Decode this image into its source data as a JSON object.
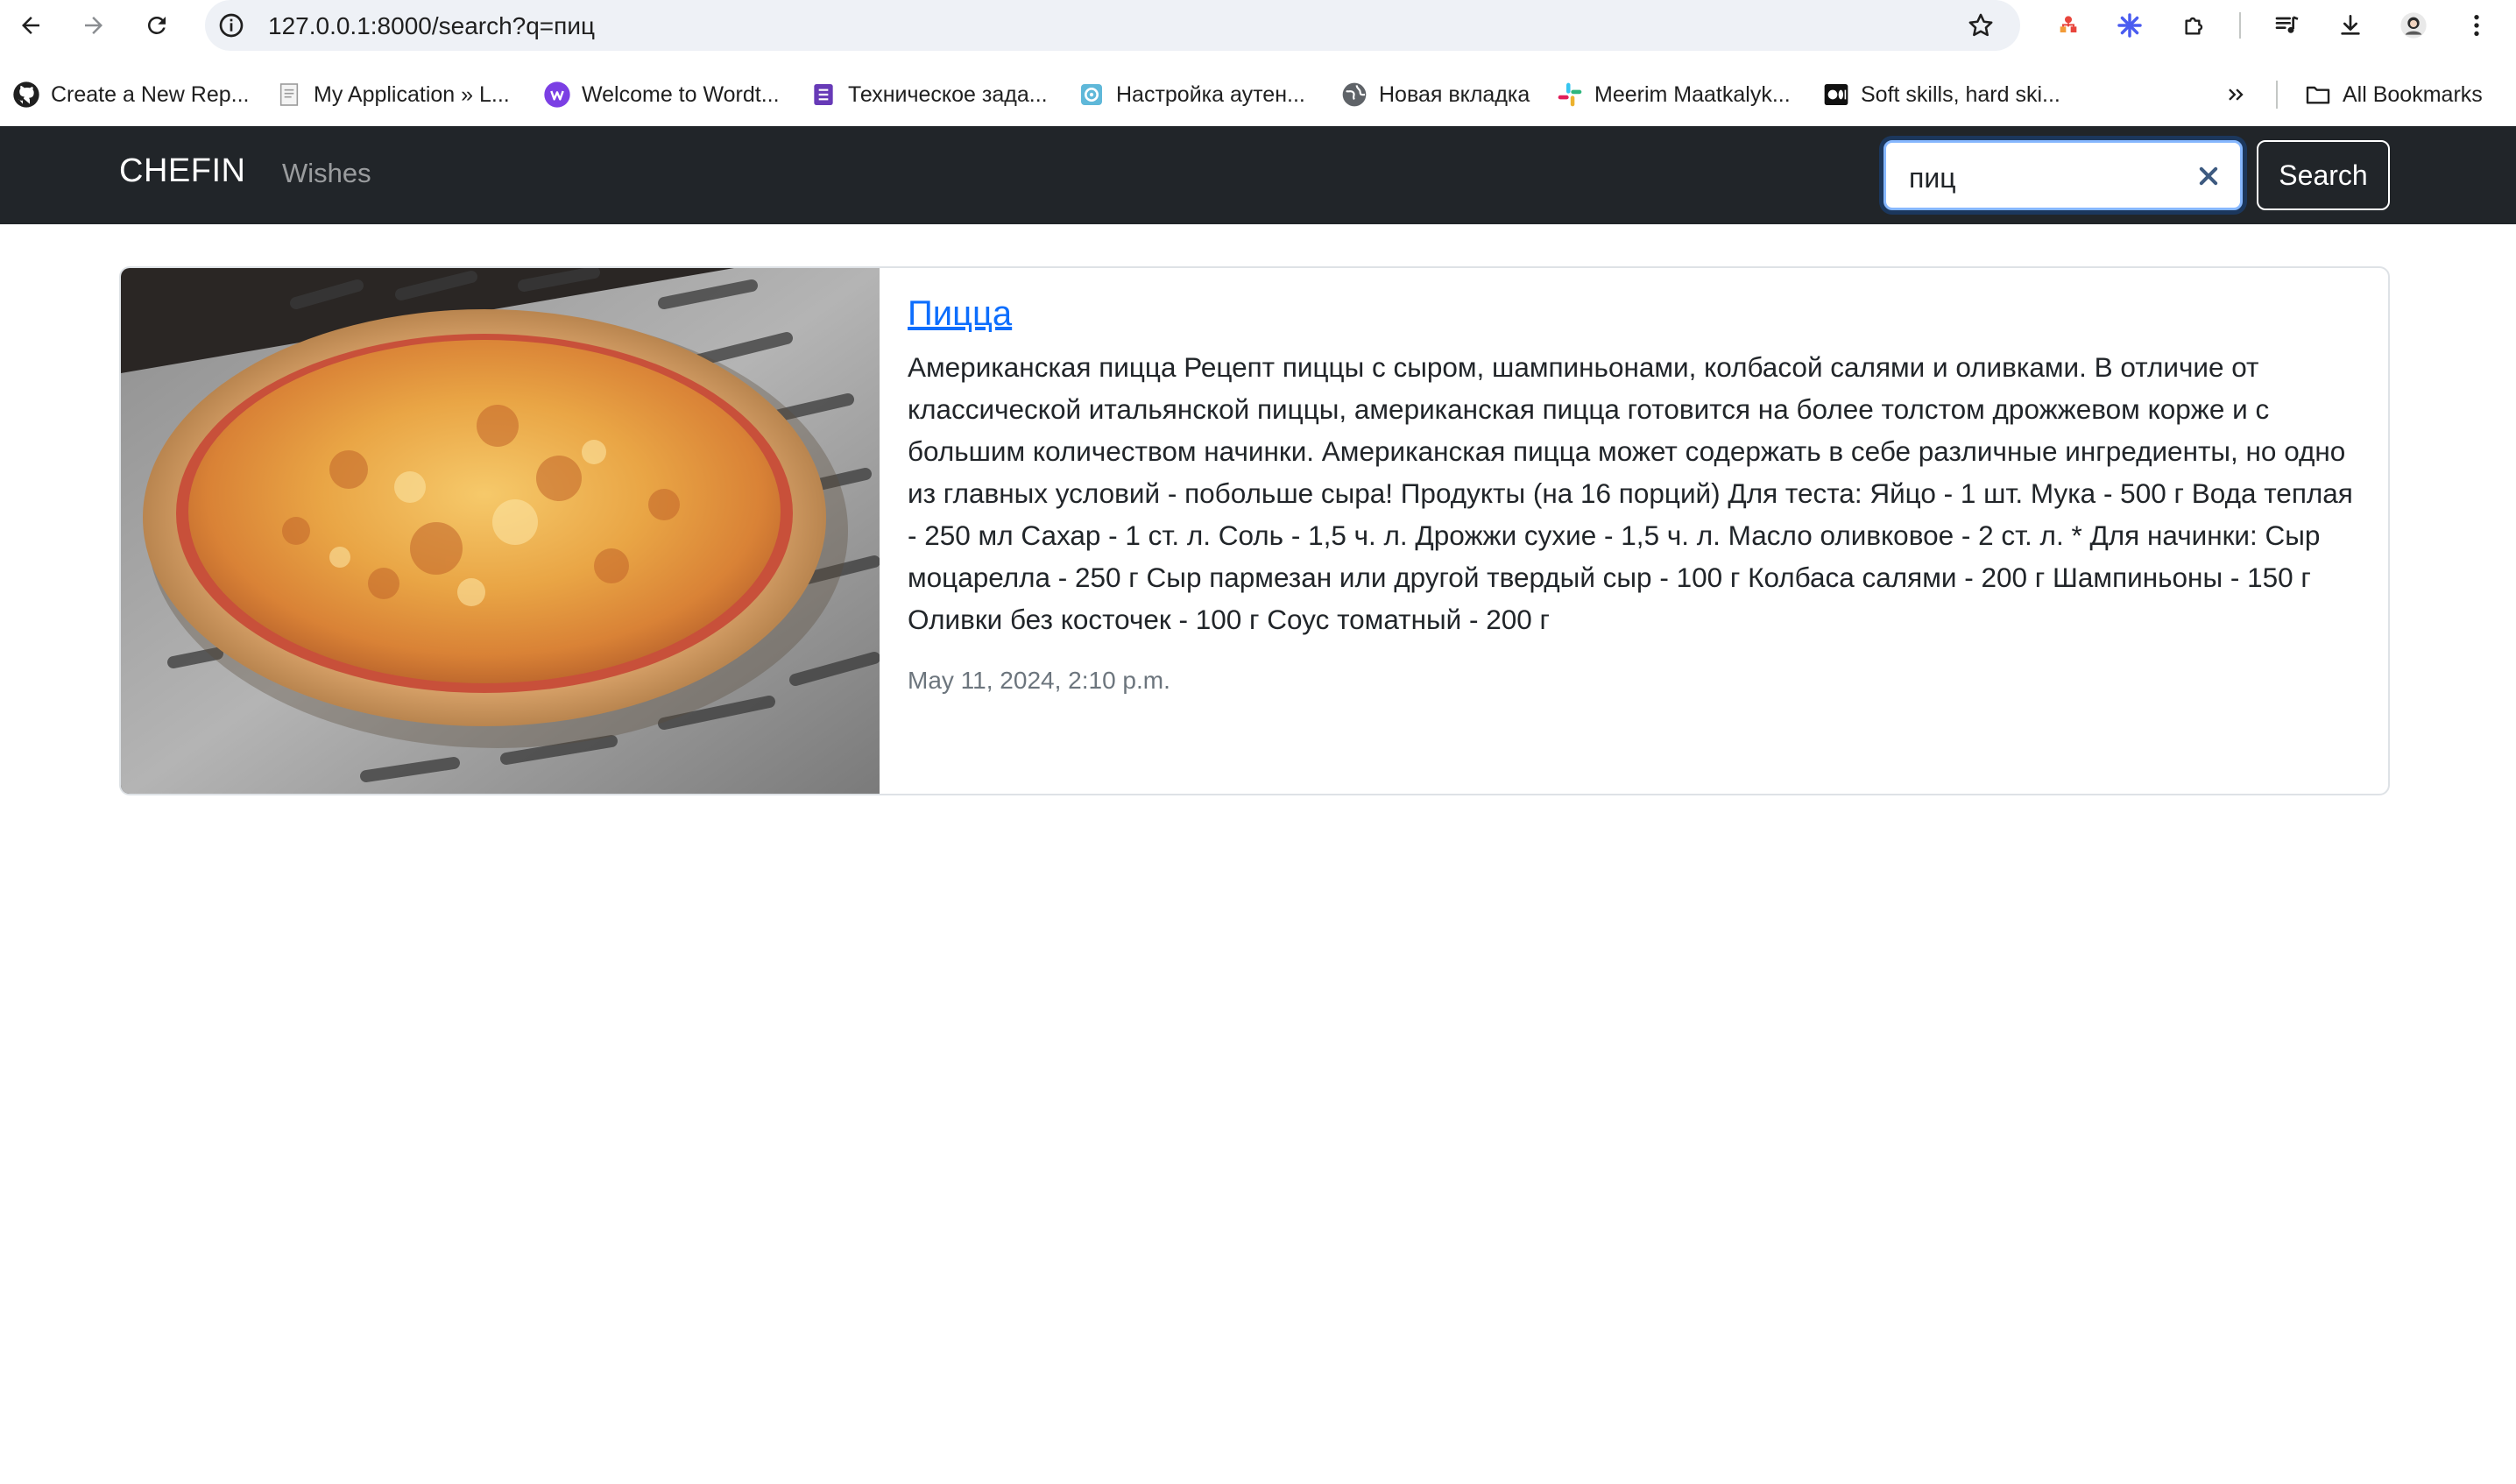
{
  "browser": {
    "url": "127.0.0.1:8000/search?q=пиц",
    "bookmarks": [
      {
        "label": "Create a New Rep...",
        "icon": "github-icon"
      },
      {
        "label": "My Application » L...",
        "icon": "document-icon"
      },
      {
        "label": "Welcome to Wordt...",
        "icon": "wordtune-icon"
      },
      {
        "label": "Техническое зада...",
        "icon": "forms-icon"
      },
      {
        "label": "Настройка аутен...",
        "icon": "gear-favicon-icon"
      },
      {
        "label": "Новая вкладка",
        "icon": "globe-icon"
      },
      {
        "label": "Meerim Maatkalyk...",
        "icon": "slack-icon"
      },
      {
        "label": "Soft skills, hard ski...",
        "icon": "medium-icon"
      }
    ],
    "all_bookmarks_label": "All Bookmarks"
  },
  "navbar": {
    "brand": "CHEFIN",
    "link": "Wishes",
    "search_value": "пиц",
    "search_button": "Search"
  },
  "results": [
    {
      "title": "Пицца",
      "description": "Американская пицца Рецепт пиццы с сыром, шампиньонами, колбасой салями и оливками. В отличие от классической итальянской пиццы, американская пицца готовится на более толстом дрожжевом корже и с большим количеством начинки. Американская пицца может содержать в себе различные ингредиенты, но одно из главных условий - побольше сыра! Продукты (на 16 порций) Для теста: Яйцо - 1 шт. Мука - 500 г Вода теплая - 250 мл Сахар - 1 ст. л. Соль - 1,5 ч. л. Дрожжи сухие - 1,5 ч. л. Масло оливковое - 2 ст. л. * Для начинки: Сыр моцарелла - 250 г Сыр пармезан или другой твердый сыр - 100 г Колбаса салями - 200 г Шампиньоны - 150 г Оливки без косточек - 100 г Соус томатный - 200 г",
      "date": "May 11, 2024, 2:10 p.m."
    }
  ]
}
